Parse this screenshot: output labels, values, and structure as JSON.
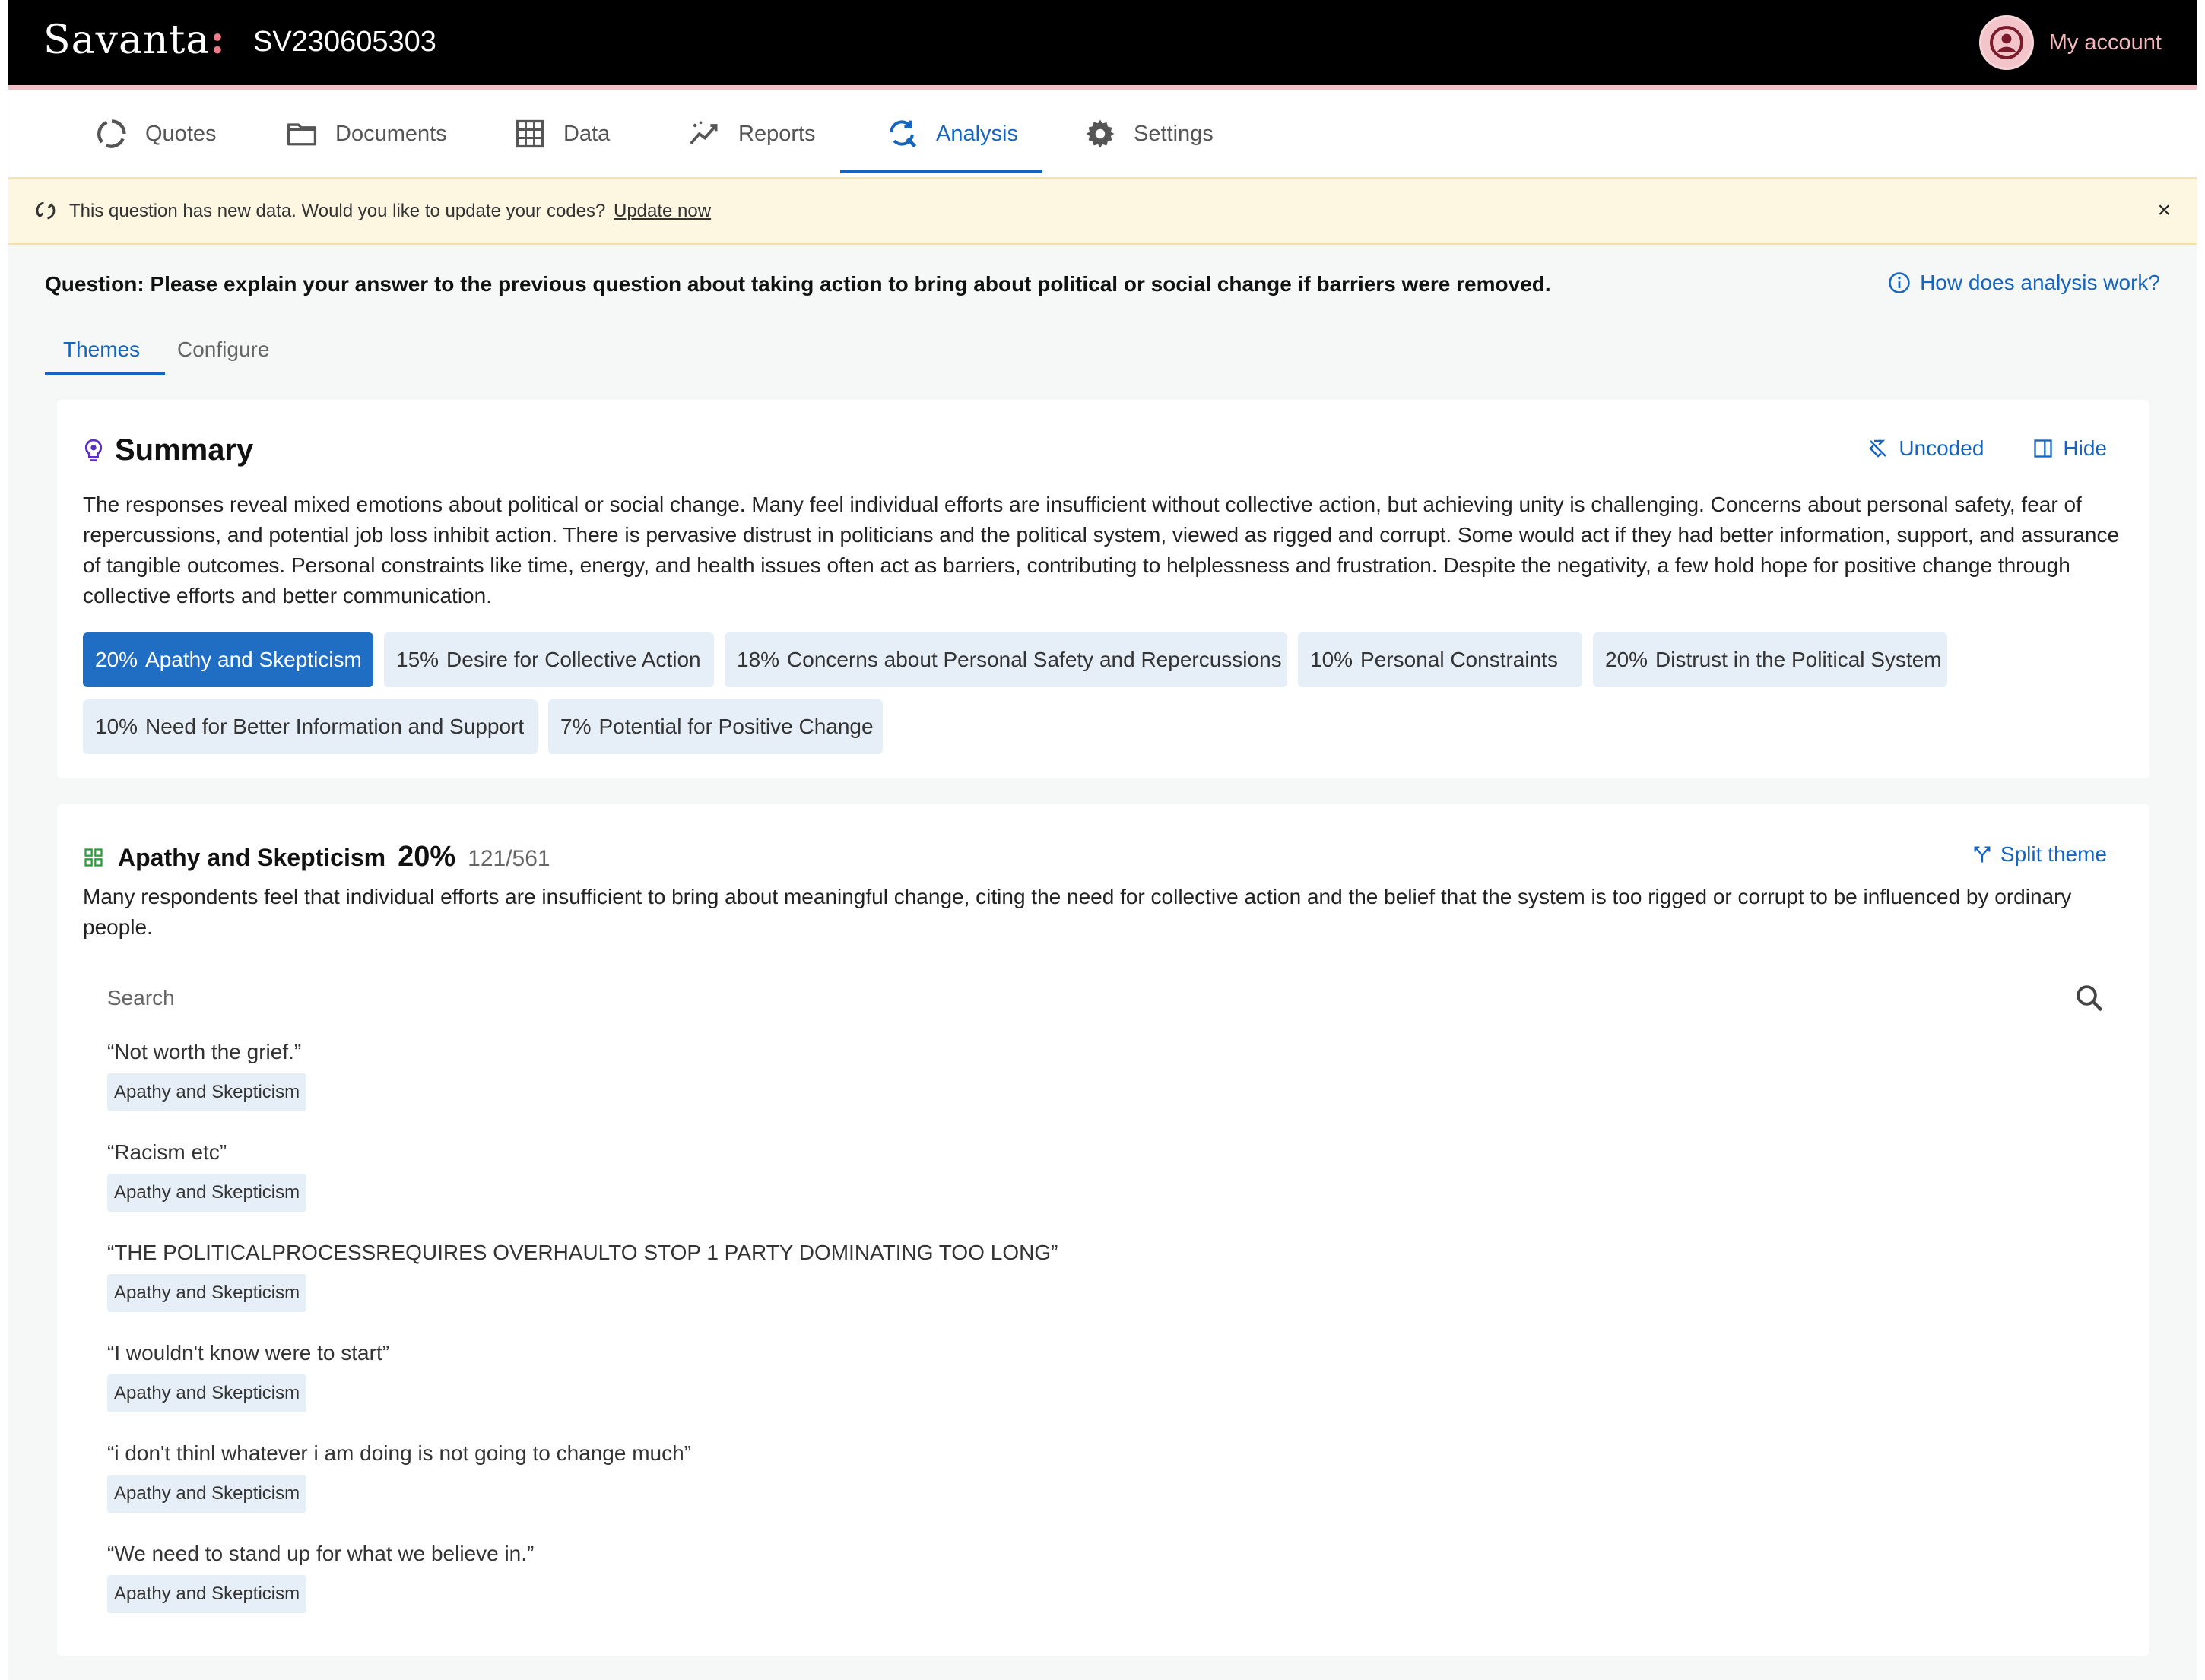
{
  "header": {
    "logo_text": "Savanta",
    "logo_mark": ":",
    "project_id": "SV230605303",
    "account_label": "My account"
  },
  "nav": {
    "tabs": [
      {
        "label": "Quotes",
        "icon": "quotes-circle-icon"
      },
      {
        "label": "Documents",
        "icon": "folder-icon"
      },
      {
        "label": "Data",
        "icon": "grid-icon"
      },
      {
        "label": "Reports",
        "icon": "trend-icon"
      },
      {
        "label": "Analysis",
        "icon": "refresh-search-icon",
        "active": true
      },
      {
        "label": "Settings",
        "icon": "gear-icon"
      }
    ]
  },
  "notice": {
    "text": "This question has new data. Would you like to update your codes?",
    "link": "Update now",
    "close": "×"
  },
  "question": {
    "text": "Question: Please explain your answer to the previous question about taking action to bring about political or social change if barriers were removed.",
    "help_link": "How does analysis work?"
  },
  "subtabs": {
    "themes": "Themes",
    "configure": "Configure"
  },
  "summary": {
    "title": "Summary",
    "uncoded_label": "Uncoded",
    "hide_label": "Hide",
    "text": "The responses reveal mixed emotions about political or social change. Many feel individual efforts are insufficient without collective action, but achieving unity is challenging. Concerns about personal safety, fear of repercussions, and potential job loss inhibit action. There is pervasive distrust in politicians and the political system, viewed as rigged and corrupt. Some would act if they had better information, support, and assurance of tangible outcomes. Personal constraints like time, energy, and health issues often act as barriers, contributing to helplessness and frustration. Despite the negativity, a few hold hope for positive change through collective efforts and better communication.",
    "chips": [
      {
        "pct": "20%",
        "label": "Apathy and Skepticism",
        "selected": true
      },
      {
        "pct": "15%",
        "label": "Desire for Collective Action"
      },
      {
        "pct": "18%",
        "label": "Concerns about Personal Safety and Repercussions"
      },
      {
        "pct": "10%",
        "label": "Personal Constraints"
      },
      {
        "pct": "20%",
        "label": "Distrust in the Political System"
      },
      {
        "pct": "10%",
        "label": "Need for Better Information and Support"
      },
      {
        "pct": "7%",
        "label": "Potential for Positive Change"
      }
    ]
  },
  "theme": {
    "title": "Apathy and Skepticism",
    "pct": "20%",
    "count": "121/561",
    "split_label": "Split theme",
    "description": "Many respondents feel that individual efforts are insufficient to bring about meaningful change, citing the need for collective action and the belief that the system is too rigged or corrupt to be influenced by ordinary people.",
    "search_placeholder": "Search",
    "quotes": [
      {
        "text": "“Not worth the grief.”",
        "tag": "Apathy and Skepticism"
      },
      {
        "text": "“Racism etc”",
        "tag": "Apathy and Skepticism"
      },
      {
        "text": "“THE POLITICALPROCESSREQUIRES OVERHAULTO STOP 1 PARTY DOMINATING TOO LONG”",
        "tag": "Apathy and Skepticism"
      },
      {
        "text": "“I wouldn't know were to start”",
        "tag": "Apathy and Skepticism"
      },
      {
        "text": "“i don't thinl whatever i am doing is not going to change much”",
        "tag": "Apathy and Skepticism"
      },
      {
        "text": "“We need to stand up for what we believe in.”",
        "tag": "Apathy and Skepticism"
      }
    ]
  },
  "colors": {
    "accent": "#1565c0",
    "chip_selected": "#1f6ec4",
    "chip_bg": "#e6eef7",
    "notice_bg": "#fdf6e1",
    "topbar_bg": "#000000",
    "brand_pink": "#f07c8a"
  }
}
